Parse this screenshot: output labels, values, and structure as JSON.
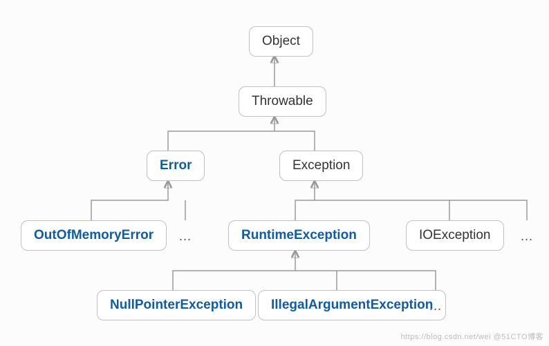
{
  "nodes": {
    "object": "Object",
    "throwable": "Throwable",
    "error": "Error",
    "exception": "Exception",
    "oom": "OutOfMemoryError",
    "runtime": "RuntimeException",
    "ioe": "IOException",
    "npe": "NullPointerException",
    "iae": "IllegalArgumentException"
  },
  "dots": "…",
  "watermark": "https://blog.csdn.net/wei @51CTO博客"
}
